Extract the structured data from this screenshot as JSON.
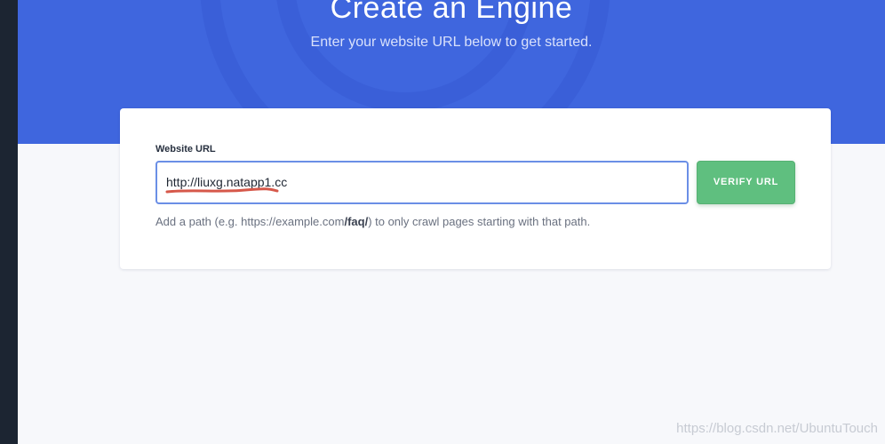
{
  "hero": {
    "title": "Create an Engine",
    "subtitle": "Enter your website URL below to get started."
  },
  "form": {
    "field_label": "Website URL",
    "url_value": "http://liuxg.natapp1.cc",
    "verify_label": "VERIFY URL",
    "help_prefix": "Add a path (e.g. https://example.com",
    "help_path": "/faq/",
    "help_suffix": ") to only crawl pages starting with that path."
  },
  "watermark": "https://blog.csdn.net/UbuntuTouch",
  "colors": {
    "hero_background": "#3f66de",
    "verify_button": "#5fbf7f",
    "input_border": "#6b8fe6",
    "annotation_underline": "#d6584a"
  }
}
